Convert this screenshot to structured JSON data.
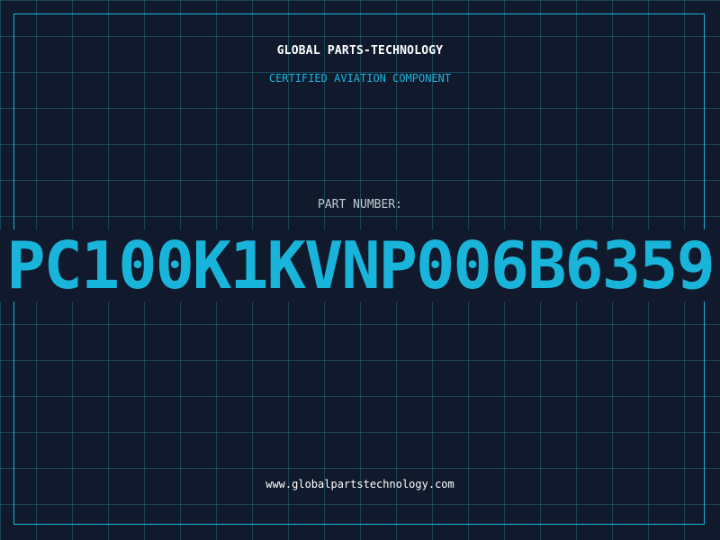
{
  "header": {
    "brand": "GLOBAL PARTS-TECHNOLOGY",
    "tagline": "CERTIFIED AVIATION COMPONENT"
  },
  "part": {
    "label": "PART NUMBER:",
    "value": "PC100K1KVNP006B6359"
  },
  "footer": {
    "website": "www.globalpartstechnology.com"
  },
  "colors": {
    "background": "#101a2c",
    "accent": "#19b4da",
    "grid": "#28788c",
    "text": "#ffffff",
    "muted": "#c4cad4"
  }
}
